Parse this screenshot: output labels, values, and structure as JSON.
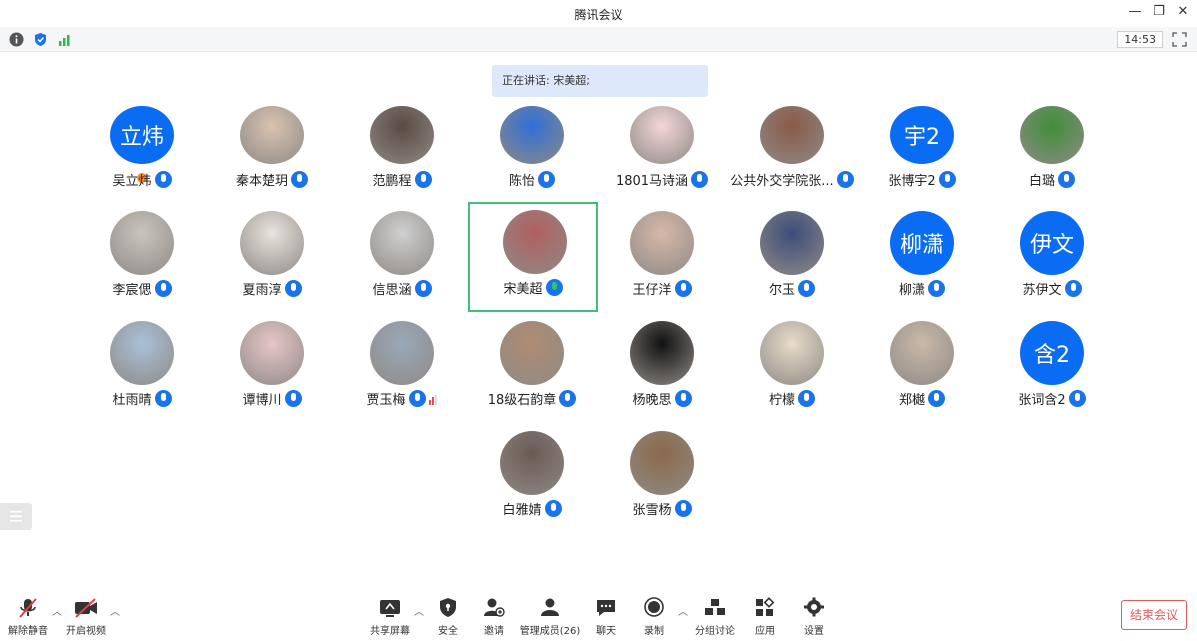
{
  "window": {
    "title": "腾讯会议"
  },
  "status": {
    "clock": "14:53"
  },
  "speaking_banner": "正在讲话: 宋美超;",
  "participants": [
    {
      "name": "吴立炜",
      "avatar_text": "立炜",
      "host": true
    },
    {
      "name": "秦本楚玥"
    },
    {
      "name": "范鹏程"
    },
    {
      "name": "陈怡"
    },
    {
      "name": "1801马诗涵"
    },
    {
      "name": "公共外交学院张..."
    },
    {
      "name": "张博宇2",
      "avatar_text": "宇2"
    },
    {
      "name": "白璐"
    },
    {
      "name": "李宸偲"
    },
    {
      "name": "夏雨淳"
    },
    {
      "name": "信思涵"
    },
    {
      "name": "宋美超",
      "speaking": true
    },
    {
      "name": "王仔洋"
    },
    {
      "name": "尔玉"
    },
    {
      "name": "柳潇",
      "avatar_text": "柳潇"
    },
    {
      "name": "苏伊文",
      "avatar_text": "伊文"
    },
    {
      "name": "杜雨晴"
    },
    {
      "name": "谭博川"
    },
    {
      "name": "贾玉梅"
    },
    {
      "name": "18级石韵章"
    },
    {
      "name": "杨晚思"
    },
    {
      "name": "柠檬"
    },
    {
      "name": "郑樾"
    },
    {
      "name": "张词含2",
      "avatar_text": "含2"
    },
    {
      "name": "白雅婧"
    },
    {
      "name": "张雪杨"
    }
  ],
  "toolbar": {
    "unmute": "解除静音",
    "start_video": "开启视频",
    "share_screen": "共享屏幕",
    "security": "安全",
    "invite": "邀请",
    "manage_members": "管理成员(26)",
    "chat": "聊天",
    "record": "录制",
    "breakout": "分组讨论",
    "apps": "应用",
    "settings": "设置",
    "end_meeting": "结束会议"
  }
}
